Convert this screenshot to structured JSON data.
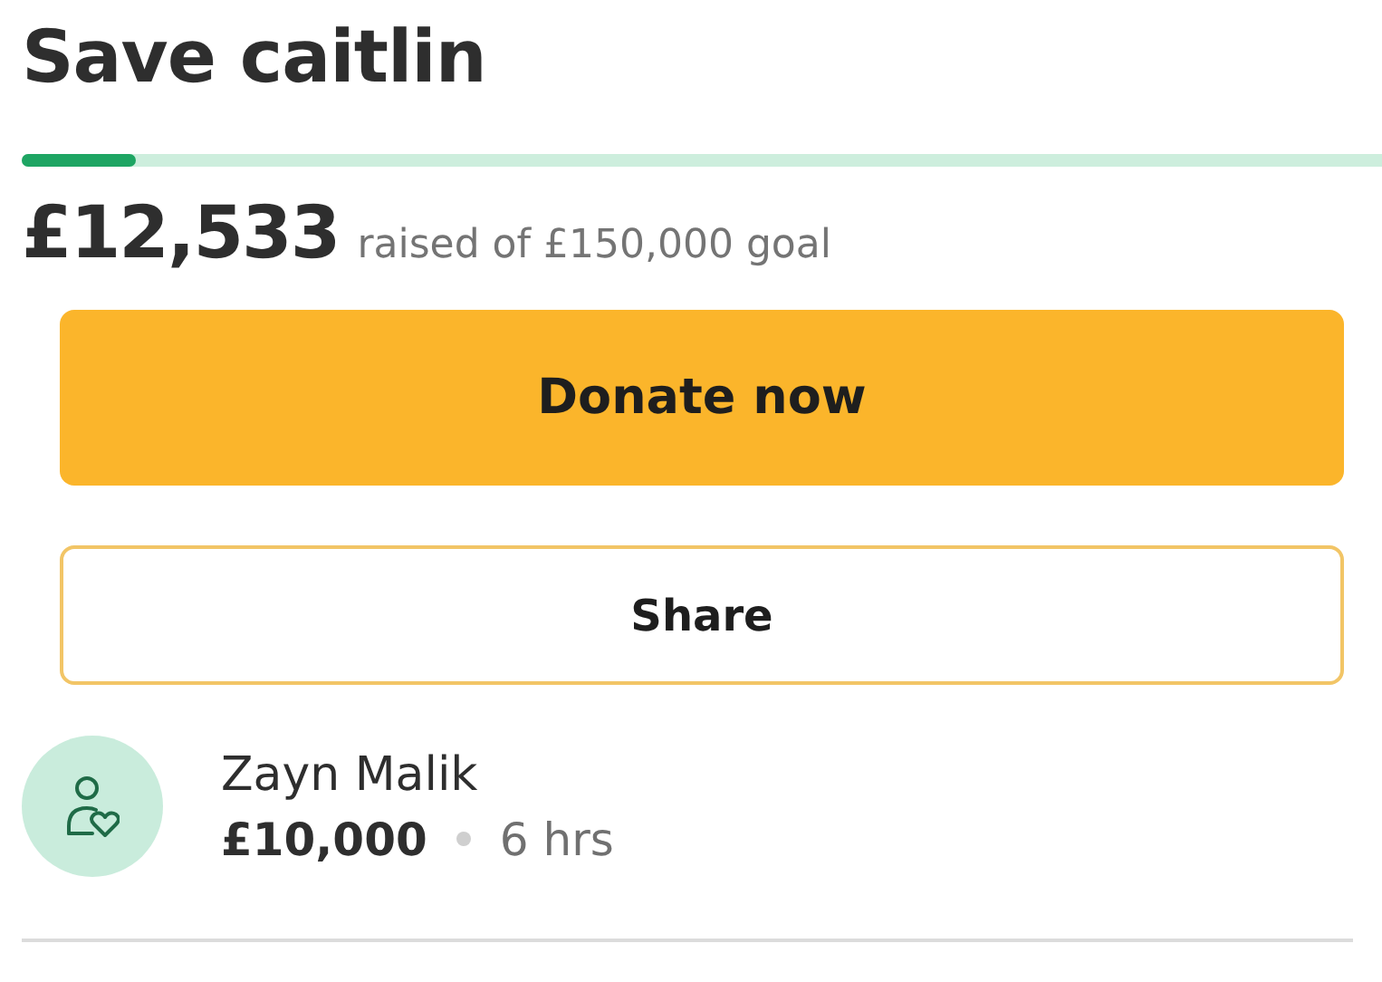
{
  "title": "Save caitlin",
  "progress": {
    "level": 0.084
  },
  "raised": {
    "amount": "£12,533",
    "caption": "raised of £150,000 goal"
  },
  "buttons": [
    {
      "label": "Donate now",
      "kind": "primary"
    },
    {
      "label": "Share",
      "kind": "outline"
    }
  ],
  "donations": [
    {
      "name": "Zayn Malik",
      "amount": "£10,000",
      "time": "6 hrs"
    }
  ]
}
